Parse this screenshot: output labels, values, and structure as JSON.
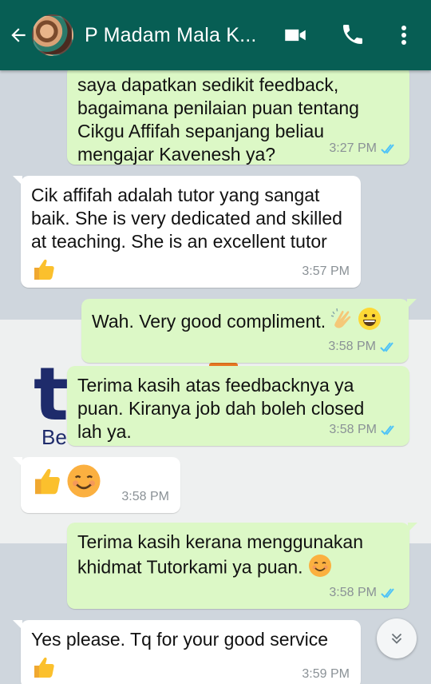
{
  "header": {
    "contact_name": "P Madam Mala K...",
    "bg_color": "#075e54"
  },
  "messages": [
    {
      "direction": "out",
      "text": "saya dapatkan sedikit feedback, bagaimana penilaian puan tentang Cikgu Affifah sepanjang beliau mengajar Kavenesh ya?",
      "time": "3:27 PM",
      "status": "read"
    },
    {
      "direction": "in",
      "text": "Cik affifah adalah tutor yang sangat baik. She is very dedicated and skilled at teaching. She is an excellent tutor",
      "emoji": "thumbs-up",
      "time": "3:57 PM"
    },
    {
      "direction": "out",
      "text": "Wah. Very good compliment.",
      "emoji": "clapping-hands grinning-face",
      "time": "3:58 PM",
      "status": "read"
    },
    {
      "direction": "out",
      "text": "Terima kasih atas feedbacknya ya puan. Kiranya job dah boleh closed lah ya.",
      "time": "3:58 PM",
      "status": "read"
    },
    {
      "direction": "in",
      "text": "",
      "emoji": "thumbs-up smiling-face",
      "time": "3:58 PM"
    },
    {
      "direction": "out",
      "text": "Terima kasih kerana menggunakan khidmat Tutorkami ya puan.",
      "emoji": "smiling-face",
      "time": "3:58 PM",
      "status": "read"
    },
    {
      "direction": "in",
      "text": "Yes please. Tq for your good service",
      "emoji": "thumbs-up",
      "time": "3:59 PM"
    }
  ],
  "wallpaper": {
    "letter": "t",
    "fragment": "Be"
  },
  "colors": {
    "outgoing": "#dcf8c6",
    "incoming": "#ffffff",
    "read_ticks": "#4fc3f7"
  }
}
